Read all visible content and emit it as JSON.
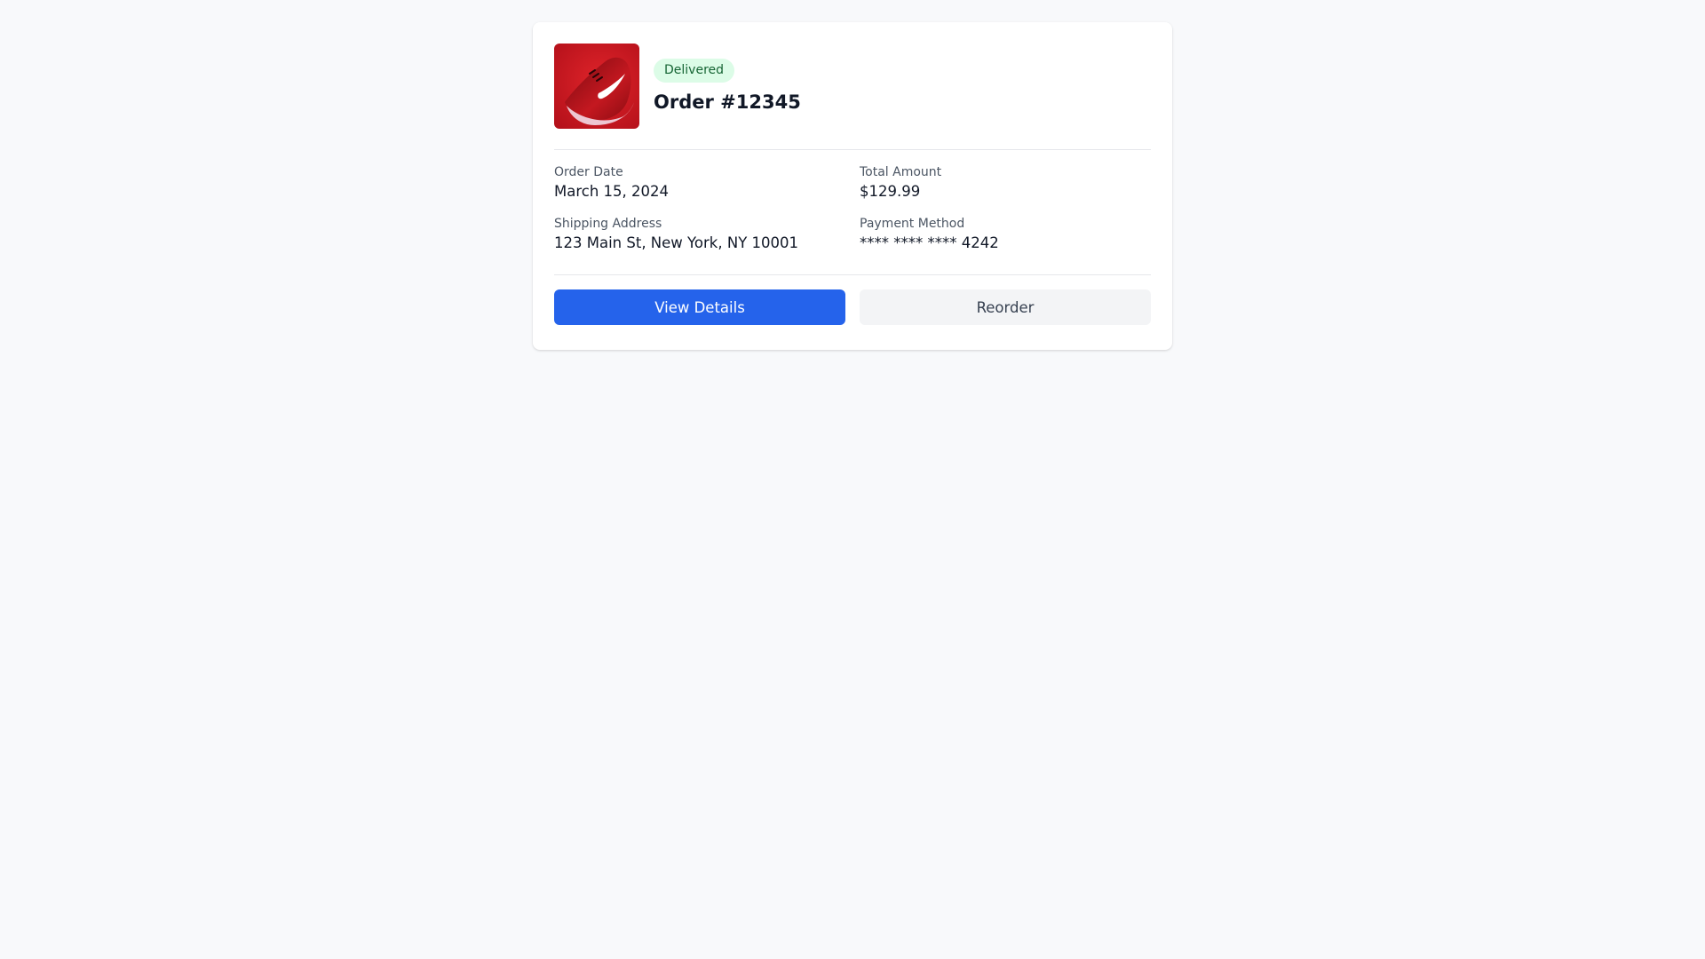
{
  "order": {
    "status": "Delivered",
    "title": "Order #12345",
    "product_image": "red-running-shoe"
  },
  "details": {
    "order_date_label": "Order Date",
    "order_date_value": "March 15, 2024",
    "total_amount_label": "Total Amount",
    "total_amount_value": "$129.99",
    "shipping_address_label": "Shipping Address",
    "shipping_address_value": "123 Main St, New York, NY 10001",
    "payment_method_label": "Payment Method",
    "payment_method_value": "**** **** **** 4242"
  },
  "actions": {
    "view_details_label": "View Details",
    "reorder_label": "Reorder"
  },
  "colors": {
    "primary": "#2563eb",
    "status_bg": "#dcfce7",
    "status_text": "#166534",
    "secondary_bg": "#f3f4f6"
  }
}
